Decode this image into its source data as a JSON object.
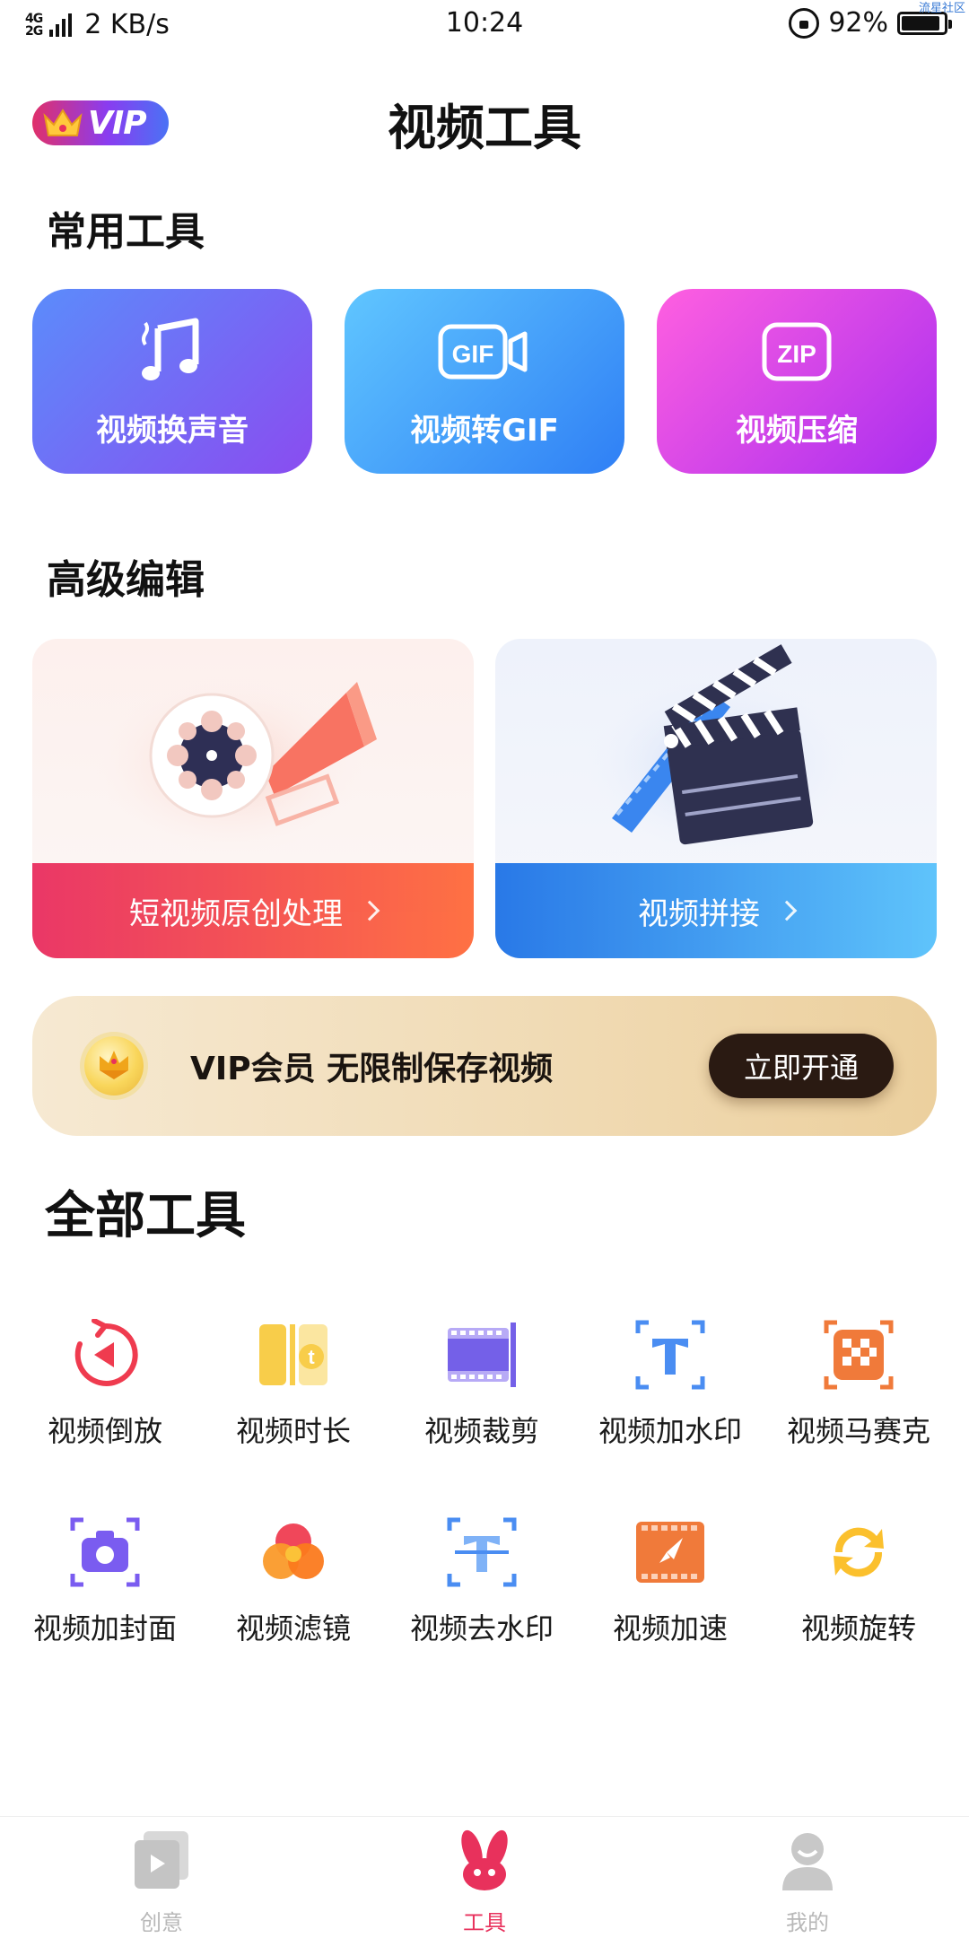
{
  "status_bar": {
    "network": "4G 2G",
    "speed": "2 KB/s",
    "time": "10:24",
    "battery": "92%",
    "battery_level": 0.92,
    "corner_mark": "流星社区"
  },
  "header": {
    "vip_badge_text": "VIP",
    "title": "视频工具"
  },
  "common_tools": {
    "section_title": "常用工具",
    "items": [
      {
        "label": "视频换声音",
        "icon": "music-note-icon"
      },
      {
        "label": "视频转GIF",
        "icon": "gif-icon"
      },
      {
        "label": "视频压缩",
        "icon": "zip-icon"
      }
    ]
  },
  "advanced_edit": {
    "section_title": "高级编辑",
    "items": [
      {
        "label": "短视频原创处理",
        "icon": "film-reel-megaphone-icon"
      },
      {
        "label": "视频拼接",
        "icon": "clapperboard-icon"
      }
    ]
  },
  "vip_banner": {
    "text": "VIP会员 无限制保存视频",
    "button": "立即开通"
  },
  "all_tools": {
    "section_title": "全部工具",
    "items": [
      {
        "label": "视频倒放",
        "icon": "reverse-icon"
      },
      {
        "label": "视频时长",
        "icon": "duration-icon"
      },
      {
        "label": "视频裁剪",
        "icon": "crop-film-icon"
      },
      {
        "label": "视频加水印",
        "icon": "add-watermark-icon"
      },
      {
        "label": "视频马赛克",
        "icon": "mosaic-icon"
      },
      {
        "label": "视频加封面",
        "icon": "cover-camera-icon"
      },
      {
        "label": "视频滤镜",
        "icon": "filter-icon"
      },
      {
        "label": "视频去水印",
        "icon": "remove-watermark-icon"
      },
      {
        "label": "视频加速",
        "icon": "speed-rocket-icon"
      },
      {
        "label": "视频旋转",
        "icon": "rotate-icon"
      }
    ]
  },
  "tab_bar": {
    "items": [
      {
        "label": "创意",
        "icon": "creative-icon",
        "active": false
      },
      {
        "label": "工具",
        "icon": "tools-bunny-icon",
        "active": true
      },
      {
        "label": "我的",
        "icon": "profile-icon",
        "active": false
      }
    ]
  },
  "colors": {
    "accent": "#e8315c",
    "vip_button": "#2a1a12"
  }
}
